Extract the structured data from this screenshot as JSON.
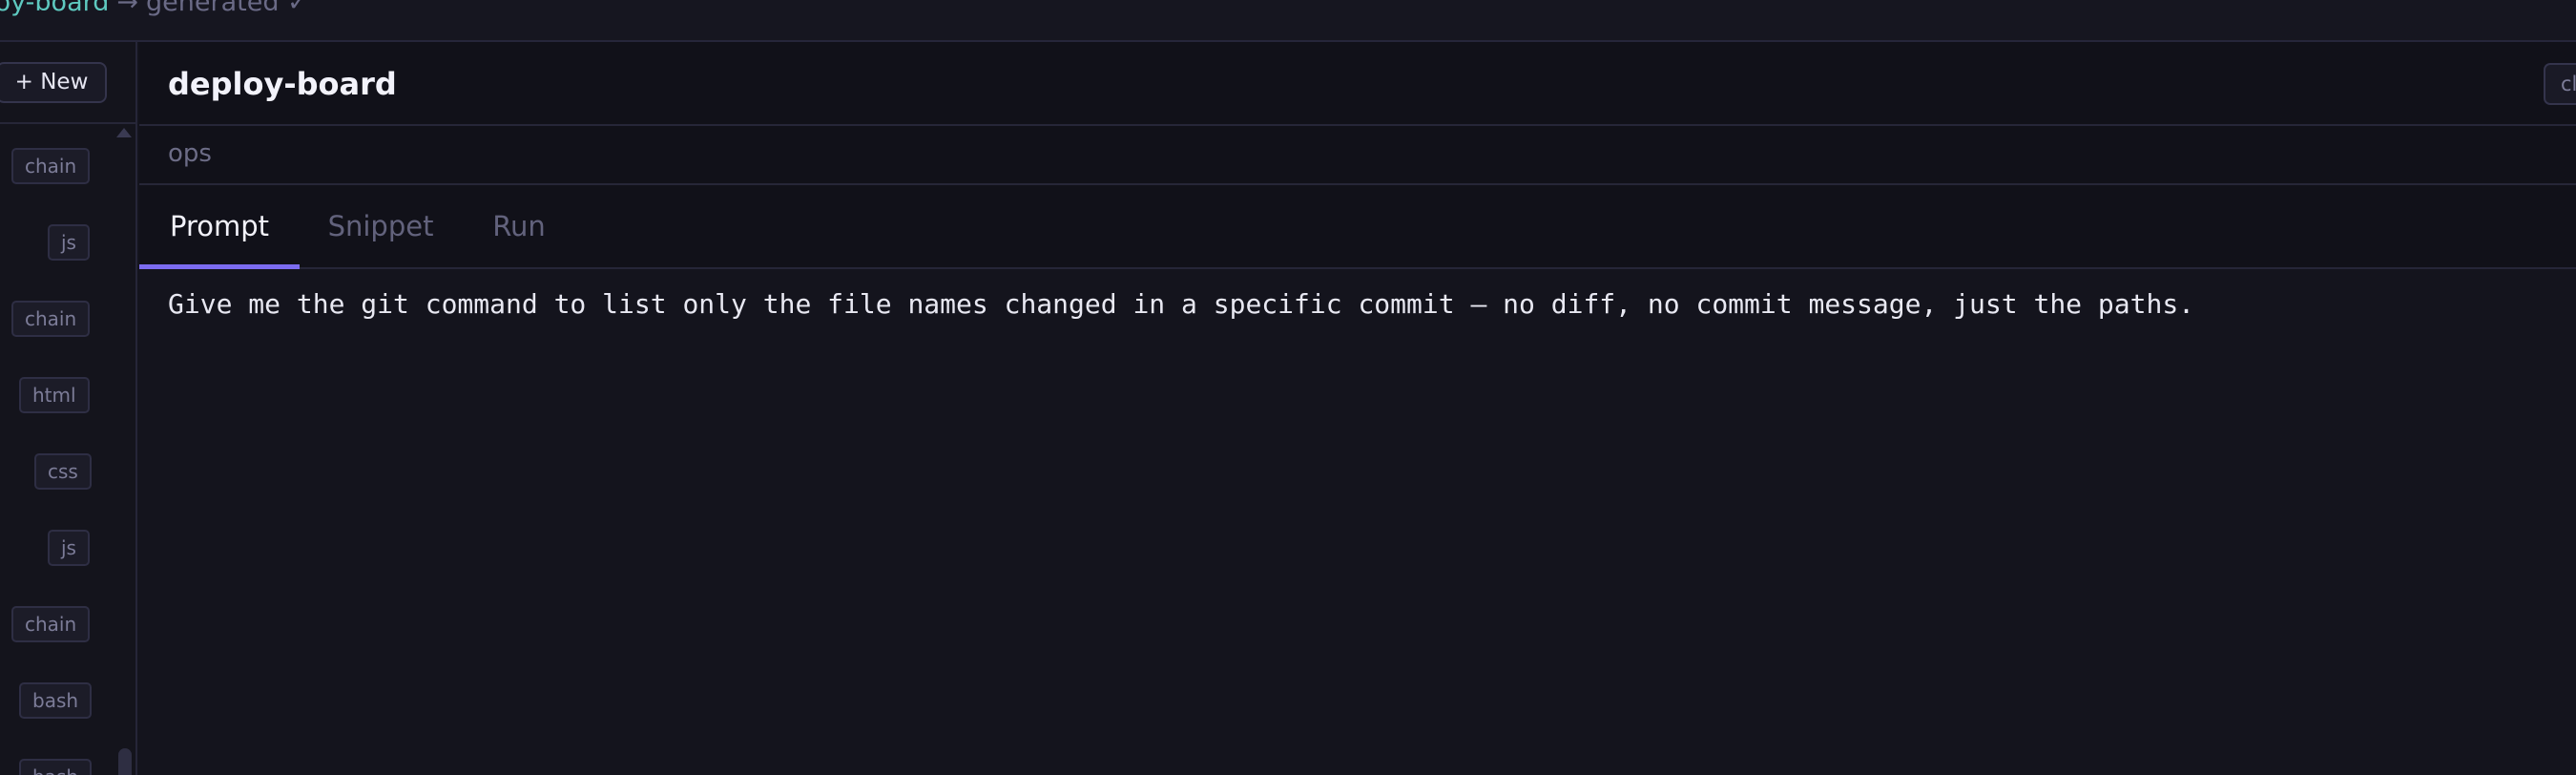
{
  "breadcrumb": {
    "project": "ploy-board",
    "arrow": "→",
    "status": "generated ✓"
  },
  "sidebar": {
    "new_button": "+ New",
    "tags": [
      "chain",
      "js",
      "chain",
      "html",
      "css",
      "js",
      "chain",
      "bash",
      "bash"
    ]
  },
  "header": {
    "title": "deploy-board",
    "right_chip": "cl"
  },
  "meta": {
    "category": "ops"
  },
  "tabs": [
    "Prompt",
    "Snippet",
    "Run"
  ],
  "active_tab": "Prompt",
  "prompt": {
    "text": "Give me the git command to list only the file names changed in a specific commit — no diff, no commit message, just the paths."
  },
  "colors": {
    "accent": "#7c6cf0",
    "project_link": "#5ec9c0",
    "background": "#14141d"
  }
}
